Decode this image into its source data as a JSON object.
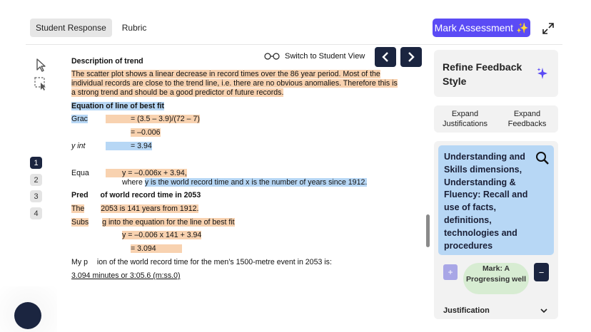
{
  "tabs": [
    {
      "label": "Student Response",
      "active": true
    },
    {
      "label": "Rubric",
      "active": false
    }
  ],
  "header": {
    "mark_button": "Mark Assessment ✨"
  },
  "toolbar": {
    "icons": [
      "cursor-icon",
      "select-region-icon"
    ]
  },
  "question_numbers": [
    "1",
    "2",
    "3",
    "4"
  ],
  "view_switch": {
    "label": "Switch to Student View"
  },
  "document": {
    "heading_trend": "Description of trend",
    "trend_para": [
      "The scatter plot shows a linear decrease in record times over the 86 year period. Most of the",
      "individual records are close to the trend line, i.e. there are no obvious anomalies. Therefore this is",
      "a strong trend and should be a good predictor of future records."
    ],
    "heading_fit": "Equation of line of best fit",
    "grad_label": "Grac",
    "grad_eq": "= (3.5 – 3.9)/(72 – 7)",
    "grad_result": "= –0.006",
    "yint_label": "y int",
    "yint_eq": "= 3.94",
    "equa_label": "Equa",
    "equa_eq": "y   = –0.006x + 3.94,",
    "where_plain": "where",
    "where_hl": "y is the world record time and x is the number of years since 1912.",
    "heading_pred_a": "Pred",
    "heading_pred_b": "of world record time in 2053",
    "the_label": "The",
    "the_text": "2053 is 141 years from 1912.",
    "subs_label": "Subs",
    "subs_text": "g into the equation for the line of best fit",
    "sub_eq": "y   = –0.006 x 141 + 3.94",
    "sub_result": "= 3.094",
    "my_pred_a": "My p",
    "my_pred_b": "ion of the world record time for the men’s 1500-metre event in 2053 is:",
    "final_answer": "3.094 minutes or 3:05.6 (m:ss.0)"
  },
  "sidebar": {
    "refine_title": "Refine Feedback Style",
    "expand_justifications": "Expand Justifications",
    "expand_feedbacks": "Expand Feedbacks",
    "criteria": "Understanding and Skills dimensions, Understanding & Fluency: Recall and use of facts, definitions, technologies and procedures",
    "mark": "Mark: A Progressing well",
    "decrement": "+",
    "increment": "−",
    "justification_label": "Justification"
  },
  "colors": {
    "accent": "#5b4bf5",
    "navy": "#1b2540",
    "highlight_orange": "#f8d2b0",
    "highlight_blue": "#b7d7f5",
    "mark_green": "#d7ecd2"
  }
}
